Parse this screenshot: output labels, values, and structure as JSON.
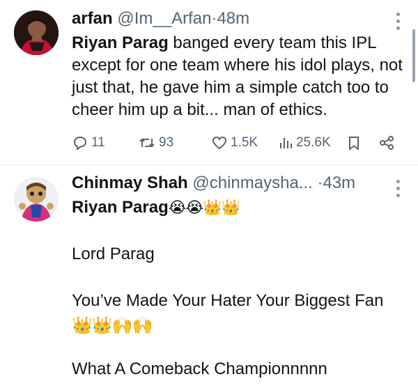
{
  "tweet1": {
    "name": "arfan",
    "handle": "@Im__Arfan",
    "separator": "·",
    "time": "48m",
    "text_bold": "Riyan Parag",
    "text_rest": " banged every team this IPL except for one team where his idol plays, not just that, he gave him a simple catch too to cheer him up a bit... man of ethics.",
    "actions": {
      "replies": "11",
      "reposts": "93",
      "likes": "1.5K",
      "views": "25.6K"
    }
  },
  "tweet2": {
    "name": "Chinmay Shah",
    "handle": "@chinmaysha...",
    "separator": "·",
    "time": "43m",
    "line1_bold": "Riyan Parag",
    "line1_emoji": "😭😭👑👑",
    "line2": "Lord Parag",
    "line3": "You’ve Made Your Hater Your Biggest Fan",
    "line4_emoji": "👑👑🙌🙌",
    "line5": "What A Comeback Championnnnn"
  }
}
